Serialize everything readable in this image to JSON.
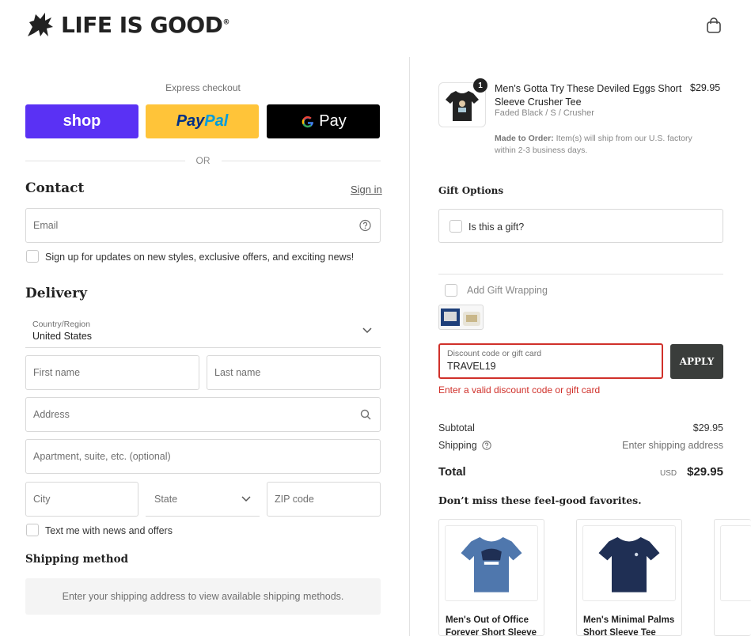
{
  "brand": {
    "name": "LIFE IS GOOD",
    "mark": "®"
  },
  "express": {
    "label": "Express checkout",
    "shop_label": "shop",
    "paypal_part1": "Pay",
    "paypal_part2": "Pal",
    "gpay_label": "Pay",
    "or_label": "OR"
  },
  "contact": {
    "title": "Contact",
    "sign_in": "Sign in",
    "email_placeholder": "Email",
    "newsletter_label": "Sign up for updates on new styles, exclusive offers, and exciting news!"
  },
  "delivery": {
    "title": "Delivery",
    "country_label": "Country/Region",
    "country_value": "United States",
    "first_name": "First name",
    "last_name": "Last name",
    "address": "Address",
    "apartment": "Apartment, suite, etc. (optional)",
    "city": "City",
    "state": "State",
    "zip": "ZIP code",
    "sms_label": "Text me with news and offers"
  },
  "shipping_method": {
    "title": "Shipping method",
    "message": "Enter your shipping address to view available shipping methods."
  },
  "cart": {
    "item": {
      "quantity": "1",
      "name": "Men's Gotta Try These Deviled Eggs Short Sleeve Crusher Tee",
      "variant": "Faded Black / S / Crusher",
      "price": "$29.95",
      "note_bold": "Made to Order:",
      "note": " Item(s) will ship from our U.S. factory within 2-3 business days."
    },
    "gift_options_title": "Gift Options",
    "is_gift_label": "Is this a gift?",
    "gift_wrap_label": "Add Gift Wrapping"
  },
  "discount": {
    "label": "Discount code or gift card",
    "value": "TRAVEL19",
    "apply": "APPLY",
    "error": "Enter a valid discount code or gift card"
  },
  "summary": {
    "subtotal_label": "Subtotal",
    "subtotal_value": "$29.95",
    "shipping_label": "Shipping",
    "shipping_value": "Enter shipping address",
    "total_label": "Total",
    "currency": "USD",
    "total_value": "$29.95"
  },
  "favorites": {
    "title": "Don’t miss these feel-good favorites.",
    "items": [
      {
        "name": "Men's Out of Office Forever Short Sleeve"
      },
      {
        "name": "Men's Minimal Palms Short Sleeve Tee"
      }
    ]
  },
  "colors": {
    "shop": "#5a31f4",
    "paypal": "#ffc439",
    "error": "#d0302a",
    "apply": "#3a3d3b",
    "tee1": "#4f77ad",
    "tee2": "#1f2f54",
    "product_tee": "#222222"
  }
}
